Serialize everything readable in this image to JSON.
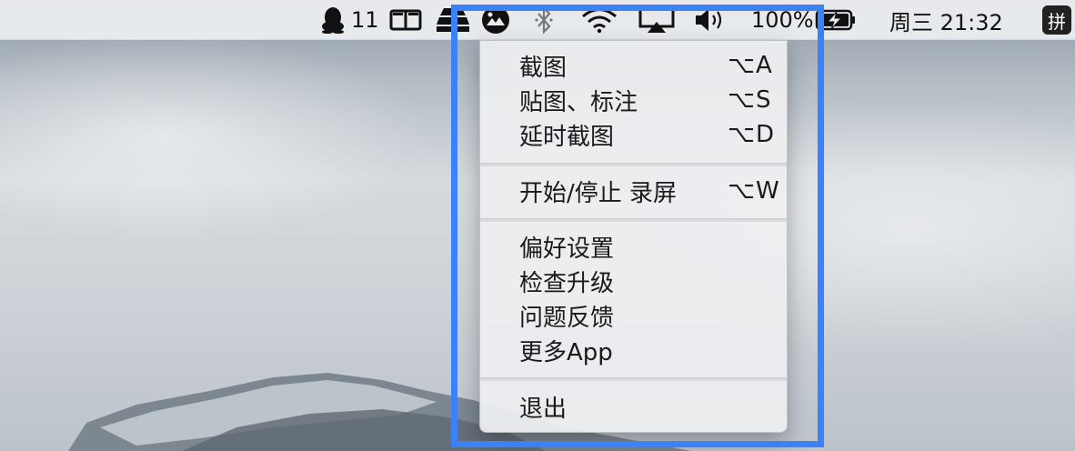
{
  "menubar": {
    "qq_count": "11",
    "battery_percent": "100%",
    "datetime": "周三 21:32",
    "input_method": "拼",
    "icons": [
      "qq-penguin-icon",
      "split-view-icon",
      "ufo-stack-icon",
      "screenshot-app-icon",
      "bluetooth-icon",
      "wifi-icon",
      "airplay-icon",
      "volume-icon",
      "battery-charging-icon"
    ]
  },
  "menu": {
    "items": [
      {
        "label": "截图",
        "shortcut": "⌥A"
      },
      {
        "label": "贴图、标注",
        "shortcut": "⌥S"
      },
      {
        "label": "延时截图",
        "shortcut": "⌥D"
      },
      {
        "label": "开始/停止 录屏",
        "shortcut": "⌥W"
      },
      {
        "label": "偏好设置",
        "shortcut": ""
      },
      {
        "label": "检查升级",
        "shortcut": ""
      },
      {
        "label": "问题反馈",
        "shortcut": ""
      },
      {
        "label": "更多App",
        "shortcut": ""
      },
      {
        "label": "退出",
        "shortcut": ""
      }
    ]
  },
  "colors": {
    "highlight": "#3b82f6",
    "menubar_bg": "#eaecef",
    "menu_bg": "#edeef0"
  }
}
